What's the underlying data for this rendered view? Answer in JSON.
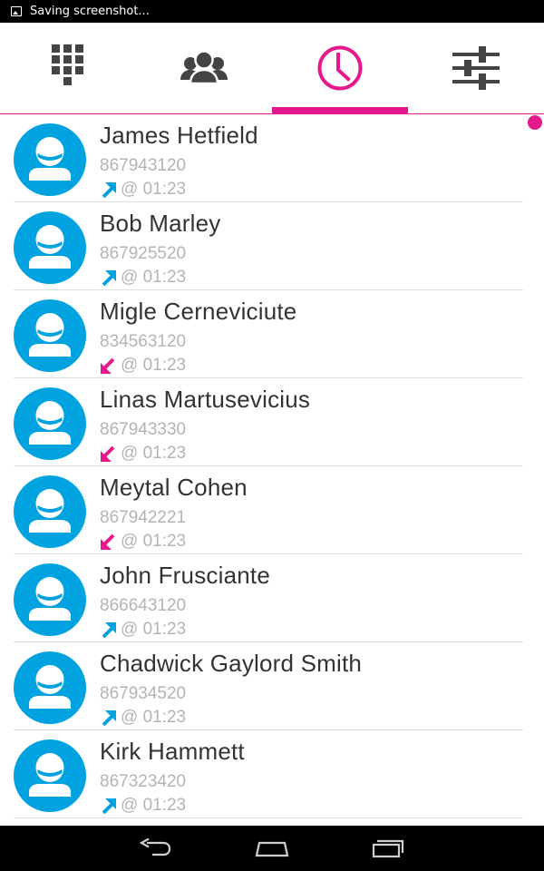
{
  "status_bar": {
    "text": "Saving screenshot...",
    "icon": "image-icon"
  },
  "tabs": [
    {
      "name": "dialpad",
      "icon": "dialpad-icon",
      "active": false
    },
    {
      "name": "contacts",
      "icon": "contacts-icon",
      "active": false
    },
    {
      "name": "recents",
      "icon": "clock-icon",
      "active": true
    },
    {
      "name": "settings",
      "icon": "sliders-icon",
      "active": false
    }
  ],
  "colors": {
    "accent": "#e5198c",
    "avatar": "#00a3e0",
    "outgoing": "#00a3e0",
    "incoming": "#e5198c",
    "icon_gray": "#444444"
  },
  "calls": [
    {
      "name": "James Hetfield",
      "number": "867943120",
      "time": "@ 01:23",
      "direction": "outgoing"
    },
    {
      "name": "Bob Marley",
      "number": "867925520",
      "time": "@ 01:23",
      "direction": "outgoing"
    },
    {
      "name": "Migle Cerneviciute",
      "number": "834563120",
      "time": "@ 01:23",
      "direction": "incoming"
    },
    {
      "name": "Linas Martusevicius",
      "number": "867943330",
      "time": "@ 01:23",
      "direction": "incoming"
    },
    {
      "name": "Meytal Cohen",
      "number": "867942221",
      "time": "@ 01:23",
      "direction": "incoming"
    },
    {
      "name": "John Frusciante",
      "number": "866643120",
      "time": "@ 01:23",
      "direction": "outgoing"
    },
    {
      "name": "Chadwick Gaylord Smith",
      "number": "867934520",
      "time": "@ 01:23",
      "direction": "outgoing"
    },
    {
      "name": "Kirk Hammett",
      "number": "867323420",
      "time": "@ 01:23",
      "direction": "outgoing"
    }
  ],
  "nav_bar": [
    {
      "icon": "back-icon"
    },
    {
      "icon": "home-icon"
    },
    {
      "icon": "recent-apps-icon"
    }
  ]
}
